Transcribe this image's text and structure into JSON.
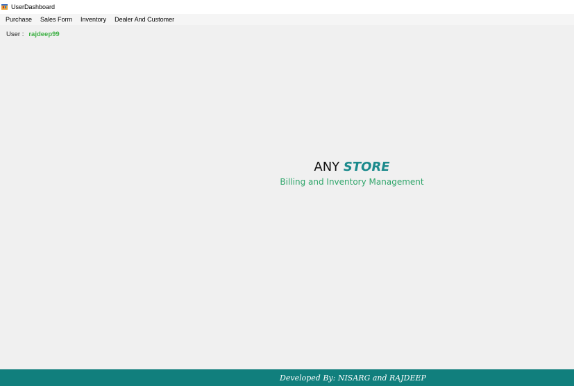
{
  "window": {
    "title": "UserDashboard",
    "icon": "app-window-icon"
  },
  "menu": {
    "items": [
      {
        "label": "Purchase"
      },
      {
        "label": "Sales Form"
      },
      {
        "label": "Inventory"
      },
      {
        "label": "Dealer And Customer"
      }
    ]
  },
  "user": {
    "label": "User :",
    "name": "rajdeep99"
  },
  "brand": {
    "title_prefix": "ANY",
    "title_highlight": "STORE",
    "subtitle": "Billing and Inventory Management"
  },
  "footer": {
    "text": "Developed By: NISARG and RAJDEEP"
  },
  "colors": {
    "background": "#f0f0f0",
    "footer": "#117f7d",
    "username": "#3cb043",
    "store": "#1b8a8c",
    "subtitle": "#2fa56a"
  }
}
